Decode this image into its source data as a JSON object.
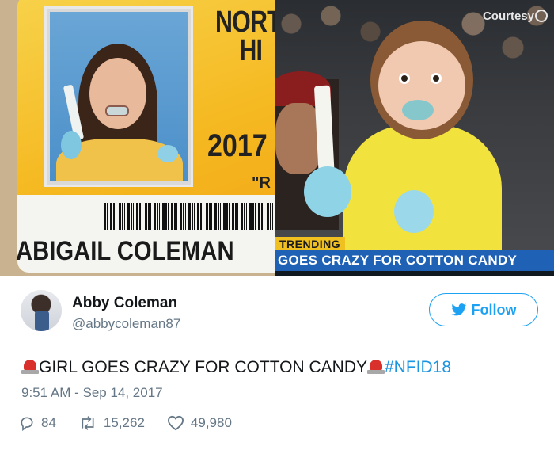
{
  "photo_left": {
    "school_line1": "NORTH",
    "school_line2": "HI",
    "year": "2017",
    "quote": "\"R",
    "student_name": "ABIGAIL COLEMAN"
  },
  "photo_right": {
    "credit": "Courtesy",
    "ticker_label": "TRENDING",
    "ticker_headline": "GOES CRAZY FOR COTTON CANDY"
  },
  "tweet": {
    "display_name": "Abby Coleman",
    "handle": "@abbycoleman87",
    "follow_label": "Follow",
    "text": "GIRL GOES CRAZY FOR COTTON CANDY",
    "hashtag": "#NFID18",
    "timestamp": "9:51 AM - Sep 14, 2017",
    "replies": "84",
    "retweets": "15,262",
    "likes": "49,980"
  },
  "icons": {
    "reply": "reply-icon",
    "retweet": "retweet-icon",
    "like": "heart-icon",
    "follow": "twitter-bird-icon",
    "emoji": "police-siren-icon"
  },
  "colors": {
    "accent": "#1da1f2",
    "hashtag": "#1b95e0",
    "muted": "#657786",
    "ticker_blue": "#1f62b5",
    "ticker_yellow": "#f0c020"
  }
}
